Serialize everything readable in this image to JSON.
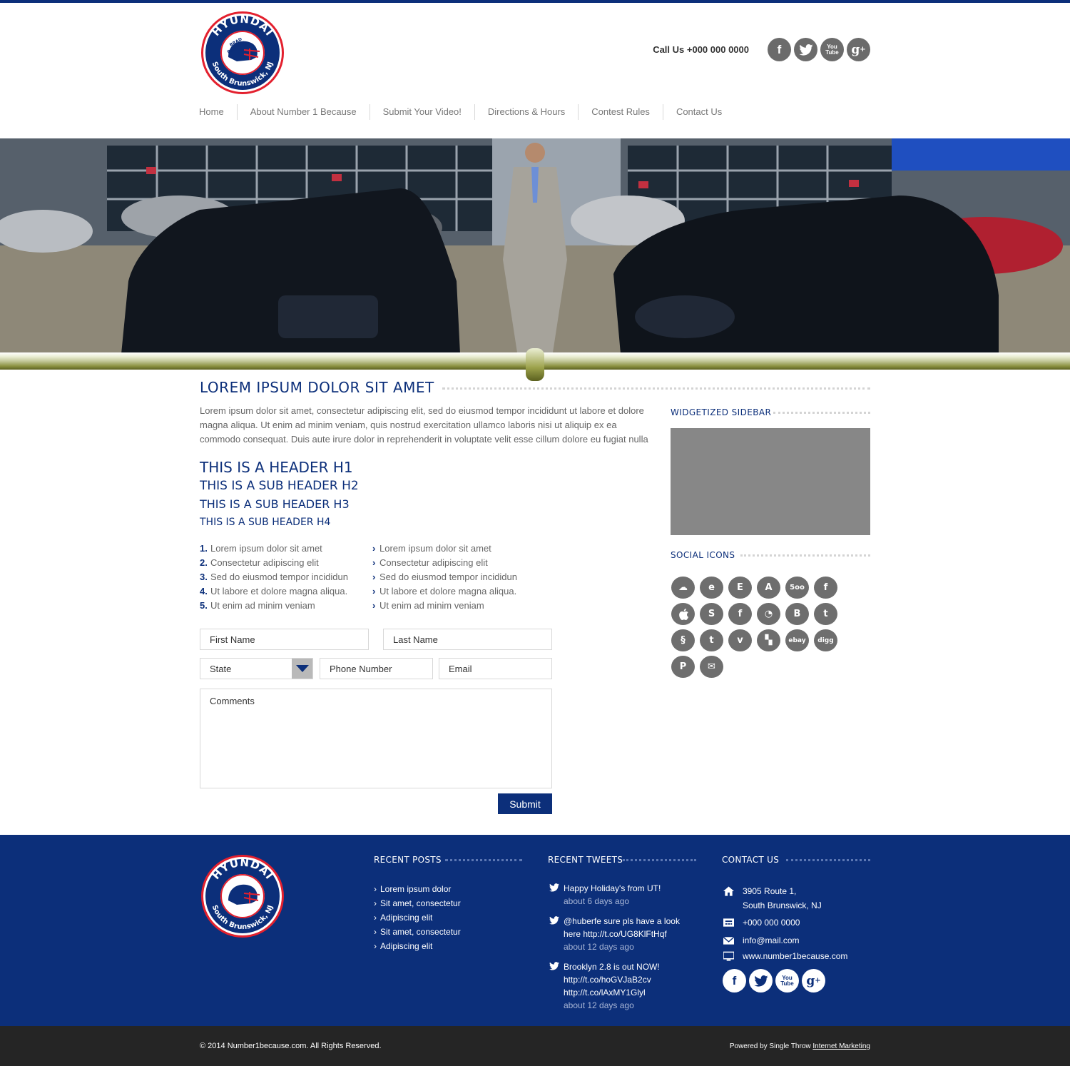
{
  "brand": {
    "logo_top": "HYUNDAI",
    "logo_bottom": "South Brunswick, NJ",
    "logo_center": "BRAD BENSON",
    "colors": {
      "navy": "#0c2f7a",
      "red": "#e3202e",
      "gray_icon": "#6b6b6b"
    }
  },
  "header": {
    "call_us": "Call Us +000 000 0000",
    "social": [
      {
        "icon": "facebook-icon",
        "glyph": "f"
      },
      {
        "icon": "twitter-icon",
        "glyph": "t"
      },
      {
        "icon": "youtube-icon",
        "glyph": "You Tube"
      },
      {
        "icon": "google-plus-icon",
        "glyph": "g+"
      }
    ]
  },
  "nav": {
    "items": [
      "Home",
      "About Number 1 Because",
      "Submit Your Video!",
      "Directions & Hours",
      "Contest Rules",
      "Contact Us"
    ]
  },
  "main": {
    "title": "LOREM IPSUM DOLOR SIT AMET",
    "intro": "Lorem ipsum dolor sit amet, consectetur adipiscing elit, sed do eiusmod tempor incididunt ut labore et dolore magna aliqua. Ut enim ad minim veniam, quis nostrud exercitation ullamco laboris nisi ut aliquip ex ea commodo consequat. Duis aute irure dolor in reprehenderit in voluptate velit esse cillum dolore eu fugiat nulla",
    "h1": "THIS IS A HEADER H1",
    "h2": "THIS IS A SUB HEADER H2",
    "h3": "THIS IS A SUB HEADER H3",
    "h4": "THIS IS A SUB HEADER H4",
    "ordered_list": [
      {
        "num": "1.",
        "text": "Lorem ipsum dolor sit amet"
      },
      {
        "num": "2.",
        "text": "Consectetur adipiscing elit"
      },
      {
        "num": "3.",
        "text": "Sed do eiusmod tempor incididun"
      },
      {
        "num": "4.",
        "text": "Ut labore et dolore magna aliqua."
      },
      {
        "num": "5.",
        "text": "Ut enim ad minim veniam"
      }
    ],
    "bullet_list": [
      "Lorem ipsum dolor sit amet",
      "Consectetur adipiscing elit",
      "Sed do eiusmod tempor incididun",
      "Ut labore et dolore magna aliqua.",
      "Ut enim ad minim veniam"
    ]
  },
  "form": {
    "first_name": "First Name",
    "last_name": "Last Name",
    "state": "State",
    "phone": "Phone Number",
    "email": "Email",
    "comments": "Comments",
    "submit": "Submit"
  },
  "sidebar": {
    "widget_title": "WIDGETIZED SIDEBAR",
    "social_title": "SOCIAL ICONS",
    "icons": [
      {
        "name": "soundcloud-icon",
        "glyph": "☁"
      },
      {
        "name": "evernote-icon",
        "glyph": "e"
      },
      {
        "name": "etsy-icon",
        "glyph": "E"
      },
      {
        "name": "app-store-icon",
        "glyph": "A"
      },
      {
        "name": "500px-icon",
        "glyph": "5oo"
      },
      {
        "name": "facebook-icon",
        "glyph": "f"
      },
      {
        "name": "apple-icon",
        "glyph": ""
      },
      {
        "name": "skype-icon",
        "glyph": "S"
      },
      {
        "name": "facebook-alt-icon",
        "glyph": "f"
      },
      {
        "name": "picasa-icon",
        "glyph": "◔"
      },
      {
        "name": "blogger-icon",
        "glyph": "B"
      },
      {
        "name": "twitter-icon",
        "glyph": "t"
      },
      {
        "name": "squarespace-icon",
        "glyph": "§"
      },
      {
        "name": "tumblr-icon",
        "glyph": "t"
      },
      {
        "name": "vimeo-icon",
        "glyph": "v"
      },
      {
        "name": "delicious-icon",
        "glyph": "▚"
      },
      {
        "name": "ebay-icon",
        "glyph": "ebay"
      },
      {
        "name": "digg-icon",
        "glyph": "digg"
      },
      {
        "name": "paypal-icon",
        "glyph": "P"
      },
      {
        "name": "mail-icon",
        "glyph": "✉"
      }
    ]
  },
  "footer": {
    "recent_posts_title": "RECENT POSTS",
    "recent_posts": [
      "Lorem ipsum dolor",
      "Sit amet, consectetur",
      "Adipiscing elit",
      "Sit amet, consectetur",
      "Adipiscing elit"
    ],
    "recent_tweets_title": "RECENT TWEETS",
    "tweets": [
      {
        "text": "Happy Holiday's from UT!",
        "ago": "about 6 days ago"
      },
      {
        "text": "@huberfe sure pls have a look here http://t.co/UG8KlFtHqf",
        "ago": "about 12 days ago"
      },
      {
        "text": "Brooklyn 2.8 is out NOW! http://t.co/hoGVJaB2cv http://t.co/lAxMY1Glyl",
        "ago": "about 12 days ago"
      }
    ],
    "contact_title": "CONTACT US",
    "address1": "3905 Route 1,",
    "address2": "South Brunswick, NJ",
    "phone": "+000 000 0000",
    "email": "info@mail.com",
    "website": "www.number1because.com"
  },
  "bottom": {
    "copyright": "© 2014 Number1because.com.  All Rights Reserved.",
    "powered_prefix": "Powered by Single Throw ",
    "powered_link": "Internet Marketing"
  }
}
